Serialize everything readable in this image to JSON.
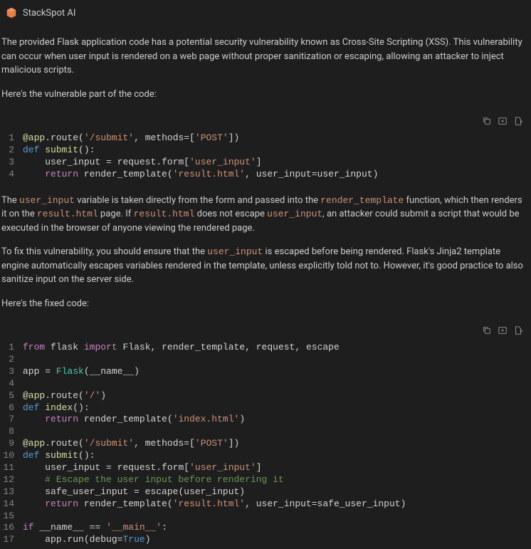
{
  "header": {
    "title": "StackSpot AI"
  },
  "para1": "The provided Flask application code has a potential security vulnerability known as Cross-Site Scripting (XSS). This vulnerability can occur when user input is rendered on a web page without proper sanitization or escaping, allowing an attacker to inject malicious scripts.",
  "para2": "Here's the vulnerable part of the code:",
  "para3_parts": {
    "t1": "The ",
    "c1": "user_input",
    "t2": " variable is taken directly from the form and passed into the ",
    "c2": "render_template",
    "t3": " function, which then renders it on the ",
    "c3": "result.html",
    "t4": " page. If ",
    "c4": "result.html",
    "t5": " does not escape ",
    "c5": "user_input",
    "t6": ", an attacker could submit a script that would be executed in the browser of anyone viewing the rendered page."
  },
  "para4_parts": {
    "t1": "To fix this vulnerability, you should ensure that the ",
    "c1": "user_input",
    "t2": " is escaped before being rendered. Flask's Jinja2 template engine automatically escapes variables rendered in the template, unless explicitly told not to. However, it's good practice to also sanitize input on the server side."
  },
  "para5": "Here's the fixed code:",
  "code1": {
    "lines": [
      {
        "n": "1",
        "tokens": [
          [
            "dec",
            "@app"
          ],
          [
            "pn",
            "."
          ],
          [
            "id",
            "route"
          ],
          [
            "pn",
            "("
          ],
          [
            "str",
            "'/submit'"
          ],
          [
            "pn",
            ", "
          ],
          [
            "id",
            "methods"
          ],
          [
            "pn",
            "=["
          ],
          [
            "str",
            "'POST'"
          ],
          [
            "pn",
            "])"
          ]
        ]
      },
      {
        "n": "2",
        "tokens": [
          [
            "def",
            "def"
          ],
          [
            "pn",
            " "
          ],
          [
            "fn",
            "submit"
          ],
          [
            "pn",
            "():"
          ]
        ]
      },
      {
        "n": "3",
        "tokens": [
          [
            "pn",
            "    "
          ],
          [
            "id",
            "user_input"
          ],
          [
            "pn",
            " = "
          ],
          [
            "id",
            "request"
          ],
          [
            "pn",
            "."
          ],
          [
            "id",
            "form"
          ],
          [
            "pn",
            "["
          ],
          [
            "str",
            "'user_input'"
          ],
          [
            "pn",
            "]"
          ]
        ]
      },
      {
        "n": "4",
        "tokens": [
          [
            "pn",
            "    "
          ],
          [
            "kw",
            "return"
          ],
          [
            "pn",
            " "
          ],
          [
            "id",
            "render_template"
          ],
          [
            "pn",
            "("
          ],
          [
            "str",
            "'result.html'"
          ],
          [
            "pn",
            ", "
          ],
          [
            "id",
            "user_input"
          ],
          [
            "pn",
            "="
          ],
          [
            "id",
            "user_input"
          ],
          [
            "pn",
            ")"
          ]
        ]
      }
    ]
  },
  "code2": {
    "lines": [
      {
        "n": "1",
        "tokens": [
          [
            "kw",
            "from"
          ],
          [
            "pn",
            " "
          ],
          [
            "id",
            "flask"
          ],
          [
            "pn",
            " "
          ],
          [
            "kw",
            "import"
          ],
          [
            "pn",
            " "
          ],
          [
            "id",
            "Flask"
          ],
          [
            "pn",
            ", "
          ],
          [
            "id",
            "render_template"
          ],
          [
            "pn",
            ", "
          ],
          [
            "id",
            "request"
          ],
          [
            "pn",
            ", "
          ],
          [
            "id",
            "escape"
          ]
        ]
      },
      {
        "n": "2",
        "tokens": [
          [
            "pn",
            ""
          ]
        ]
      },
      {
        "n": "3",
        "tokens": [
          [
            "id",
            "app"
          ],
          [
            "pn",
            " = "
          ],
          [
            "cls",
            "Flask"
          ],
          [
            "pn",
            "("
          ],
          [
            "id",
            "__name__"
          ],
          [
            "pn",
            ")"
          ]
        ]
      },
      {
        "n": "4",
        "tokens": [
          [
            "pn",
            ""
          ]
        ]
      },
      {
        "n": "5",
        "tokens": [
          [
            "dec",
            "@app"
          ],
          [
            "pn",
            "."
          ],
          [
            "id",
            "route"
          ],
          [
            "pn",
            "("
          ],
          [
            "str",
            "'/'"
          ],
          [
            "pn",
            ")"
          ]
        ]
      },
      {
        "n": "6",
        "tokens": [
          [
            "def",
            "def"
          ],
          [
            "pn",
            " "
          ],
          [
            "fn",
            "index"
          ],
          [
            "pn",
            "():"
          ]
        ]
      },
      {
        "n": "7",
        "tokens": [
          [
            "pn",
            "    "
          ],
          [
            "kw",
            "return"
          ],
          [
            "pn",
            " "
          ],
          [
            "id",
            "render_template"
          ],
          [
            "pn",
            "("
          ],
          [
            "str",
            "'index.html'"
          ],
          [
            "pn",
            ")"
          ]
        ]
      },
      {
        "n": "8",
        "tokens": [
          [
            "pn",
            ""
          ]
        ]
      },
      {
        "n": "9",
        "tokens": [
          [
            "dec",
            "@app"
          ],
          [
            "pn",
            "."
          ],
          [
            "id",
            "route"
          ],
          [
            "pn",
            "("
          ],
          [
            "str",
            "'/submit'"
          ],
          [
            "pn",
            ", "
          ],
          [
            "id",
            "methods"
          ],
          [
            "pn",
            "=["
          ],
          [
            "str",
            "'POST'"
          ],
          [
            "pn",
            "])"
          ]
        ]
      },
      {
        "n": "10",
        "tokens": [
          [
            "def",
            "def"
          ],
          [
            "pn",
            " "
          ],
          [
            "fn",
            "submit"
          ],
          [
            "pn",
            "():"
          ]
        ]
      },
      {
        "n": "11",
        "tokens": [
          [
            "pn",
            "    "
          ],
          [
            "id",
            "user_input"
          ],
          [
            "pn",
            " = "
          ],
          [
            "id",
            "request"
          ],
          [
            "pn",
            "."
          ],
          [
            "id",
            "form"
          ],
          [
            "pn",
            "["
          ],
          [
            "str",
            "'user_input'"
          ],
          [
            "pn",
            "]"
          ]
        ]
      },
      {
        "n": "12",
        "tokens": [
          [
            "pn",
            "    "
          ],
          [
            "cmt",
            "# Escape the user input before rendering it"
          ]
        ]
      },
      {
        "n": "13",
        "tokens": [
          [
            "pn",
            "    "
          ],
          [
            "id",
            "safe_user_input"
          ],
          [
            "pn",
            " = "
          ],
          [
            "id",
            "escape"
          ],
          [
            "pn",
            "("
          ],
          [
            "id",
            "user_input"
          ],
          [
            "pn",
            ")"
          ]
        ]
      },
      {
        "n": "14",
        "tokens": [
          [
            "pn",
            "    "
          ],
          [
            "kw",
            "return"
          ],
          [
            "pn",
            " "
          ],
          [
            "id",
            "render_template"
          ],
          [
            "pn",
            "("
          ],
          [
            "str",
            "'result.html'"
          ],
          [
            "pn",
            ", "
          ],
          [
            "id",
            "user_input"
          ],
          [
            "pn",
            "="
          ],
          [
            "id",
            "safe_user_input"
          ],
          [
            "pn",
            ")"
          ]
        ]
      },
      {
        "n": "15",
        "tokens": [
          [
            "pn",
            ""
          ]
        ]
      },
      {
        "n": "16",
        "tokens": [
          [
            "kw",
            "if"
          ],
          [
            "pn",
            " "
          ],
          [
            "id",
            "__name__"
          ],
          [
            "pn",
            " == "
          ],
          [
            "str",
            "'__main__'"
          ],
          [
            "pn",
            ":"
          ]
        ]
      },
      {
        "n": "17",
        "tokens": [
          [
            "pn",
            "    "
          ],
          [
            "id",
            "app"
          ],
          [
            "pn",
            "."
          ],
          [
            "id",
            "run"
          ],
          [
            "pn",
            "("
          ],
          [
            "id",
            "debug"
          ],
          [
            "pn",
            "="
          ],
          [
            "bool",
            "True"
          ],
          [
            "pn",
            ")"
          ]
        ]
      }
    ]
  }
}
